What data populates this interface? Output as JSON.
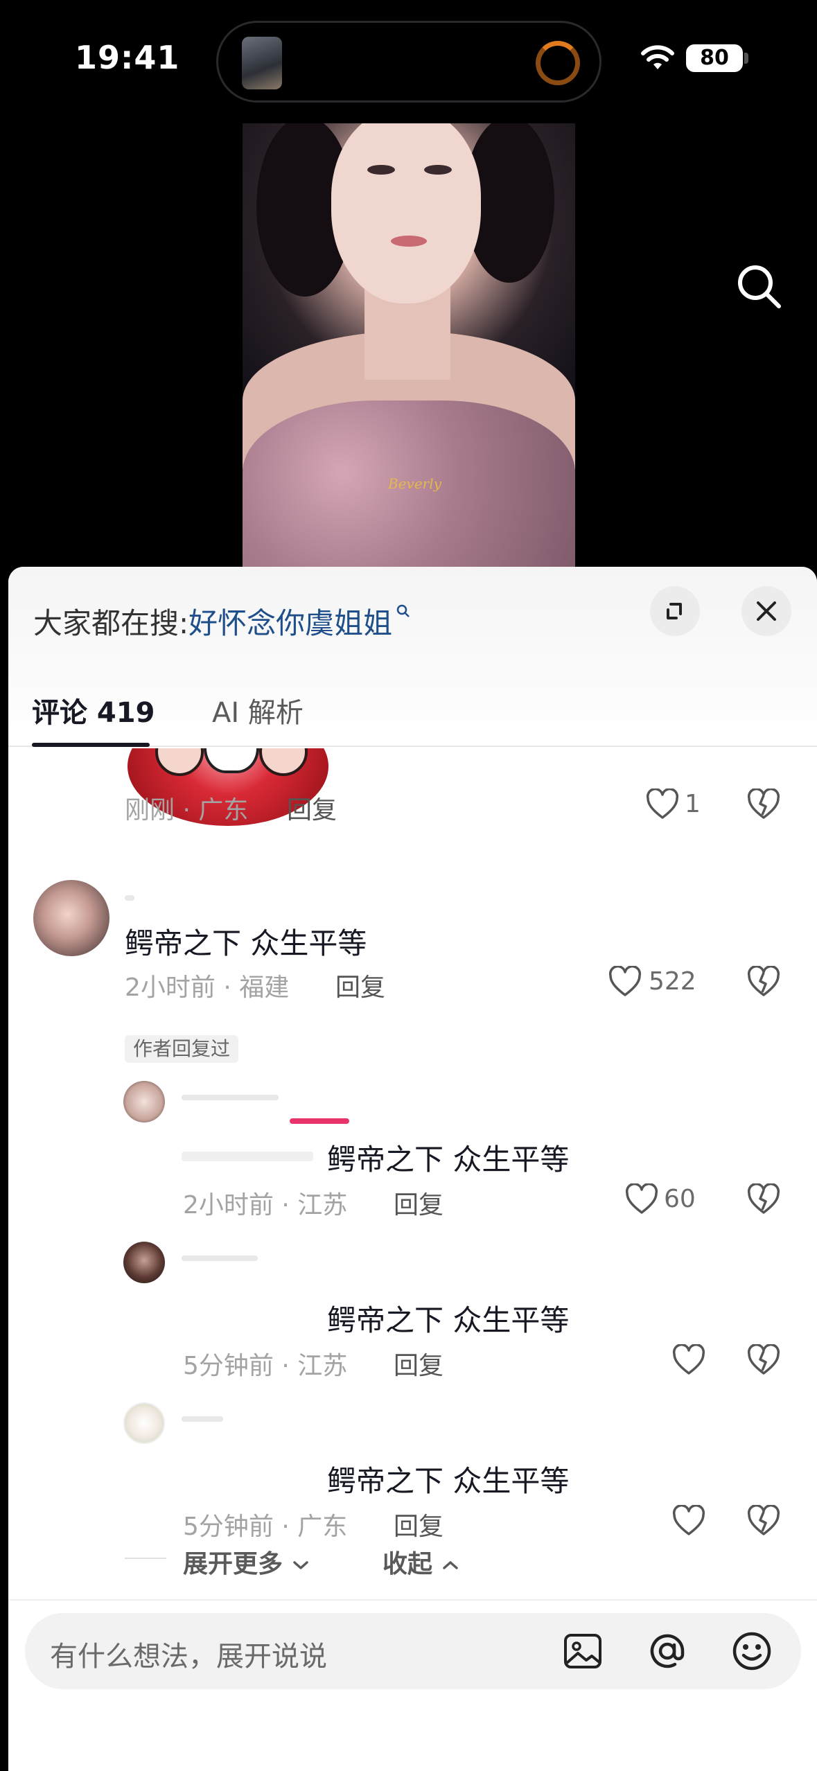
{
  "status_bar": {
    "time": "19:41",
    "battery": "80"
  },
  "video": {
    "watermark": "Beverly"
  },
  "sheet": {
    "search_hint_prefix": "大家都在搜:",
    "search_hint_keyword": "好怀念你虞姐姐",
    "tabs": [
      {
        "label": "评论 419",
        "active": true
      },
      {
        "label": "AI 解析",
        "active": false
      }
    ]
  },
  "comments": [
    {
      "meta": "刚刚 · 广东",
      "reply": "回复",
      "likes": "1"
    },
    {
      "text": "鳄帝之下 众生平等",
      "meta": "2小时前 · 福建",
      "reply": "回复",
      "likes": "522",
      "badge": "作者回复过"
    }
  ],
  "replies": [
    {
      "text": "鳄帝之下 众生平等",
      "meta": "2小时前 · 江苏",
      "reply": "回复",
      "likes": "60"
    },
    {
      "text": "鳄帝之下 众生平等",
      "meta": "5分钟前 · 江苏",
      "reply": "回复",
      "likes": ""
    },
    {
      "text": "鳄帝之下 众生平等",
      "meta": "5分钟前 · 广东",
      "reply": "回复",
      "likes": ""
    }
  ],
  "thread_controls": {
    "expand_more": "展开更多",
    "collapse": "收起"
  },
  "input_bar": {
    "placeholder": "有什么想法，展开说说"
  },
  "colors": {
    "keyword": "#1f4f8a",
    "accent_pink": "#e8346a",
    "meta_gray": "#a3a3a3"
  },
  "icons": [
    "search-icon",
    "wifi-icon",
    "expand-icon",
    "close-icon",
    "heart-icon",
    "dislike-icon",
    "chevron-down-icon",
    "chevron-up-icon",
    "image-icon",
    "at-icon",
    "emoji-icon"
  ]
}
